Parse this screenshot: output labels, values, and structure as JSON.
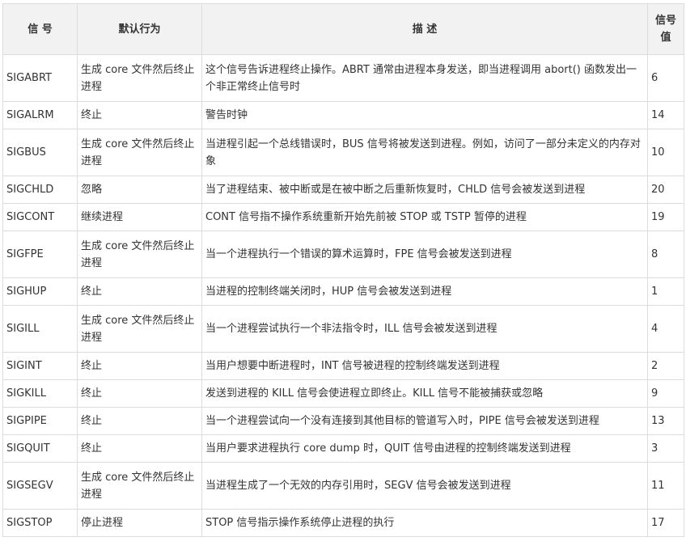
{
  "table": {
    "headers": {
      "name": "信 号",
      "action": "默认行为",
      "desc": "描 述",
      "value_line1": "信号",
      "value_line2": "值"
    },
    "rows": [
      {
        "name": "SIGABRT",
        "action": "生成 core 文件然后终止进程",
        "desc": "这个信号告诉进程终止操作。ABRT 通常由进程本身发送，即当进程调用 abort() 函数发出一个非正常终止信号时",
        "value": "6"
      },
      {
        "name": "SIGALRM",
        "action": "终止",
        "desc": "警告时钟",
        "value": "14"
      },
      {
        "name": "SIGBUS",
        "action": "生成 core 文件然后终止进程",
        "desc": "当进程引起一个总线错误时，BUS 信号将被发送到进程。例如，访问了一部分未定义的内存对象",
        "value": "10"
      },
      {
        "name": "SIGCHLD",
        "action": "忽略",
        "desc": "当了进程结束、被中断或是在被中断之后重新恢复时，CHLD 信号会被发送到进程",
        "value": "20"
      },
      {
        "name": "SIGCONT",
        "action": "继续进程",
        "desc": "CONT 信号指不操作系统重新开始先前被 STOP 或 TSTP 暂停的进程",
        "value": "19"
      },
      {
        "name": "SIGFPE",
        "action": "生成 core 文件然后终止进程",
        "desc": "当一个进程执行一个错误的算术运算时，FPE 信号会被发送到进程",
        "value": "8"
      },
      {
        "name": "SIGHUP",
        "action": "终止",
        "desc": "当进程的控制终端关闭时，HUP 信号会被发送到进程",
        "value": "1"
      },
      {
        "name": "SIGILL",
        "action": "生成 core 文件然后终止进程",
        "desc": "当一个进程尝试执行一个非法指令时，ILL 信号会被发送到进程",
        "value": "4"
      },
      {
        "name": "SIGINT",
        "action": "终止",
        "desc": "当用户想要中断进程时，INT 信号被进程的控制终端发送到进程",
        "value": "2"
      },
      {
        "name": "SIGKILL",
        "action": "终止",
        "desc": "发送到进程的 KILL 信号会使进程立即终止。KILL 信号不能被捕获或忽略",
        "value": "9"
      },
      {
        "name": "SIGPIPE",
        "action": "终止",
        "desc": "当一个进程尝试向一个没有连接到其他目标的管道写入时，PIPE 信号会被发送到进程",
        "value": "13"
      },
      {
        "name": "SIGQUIT",
        "action": "终止",
        "desc": "当用户要求进程执行 core dump 时，QUIT 信号由进程的控制终端发送到进程",
        "value": "3"
      },
      {
        "name": "SIGSEGV",
        "action": "生成 core 文件然后终止进程",
        "desc": "当进程生成了一个无效的内存引用时，SEGV 信号会被发送到进程",
        "value": "11"
      },
      {
        "name": "SIGSTOP",
        "action": "停止进程",
        "desc": "STOP 信号指示操作系统停止进程的执行",
        "value": "17"
      }
    ]
  }
}
